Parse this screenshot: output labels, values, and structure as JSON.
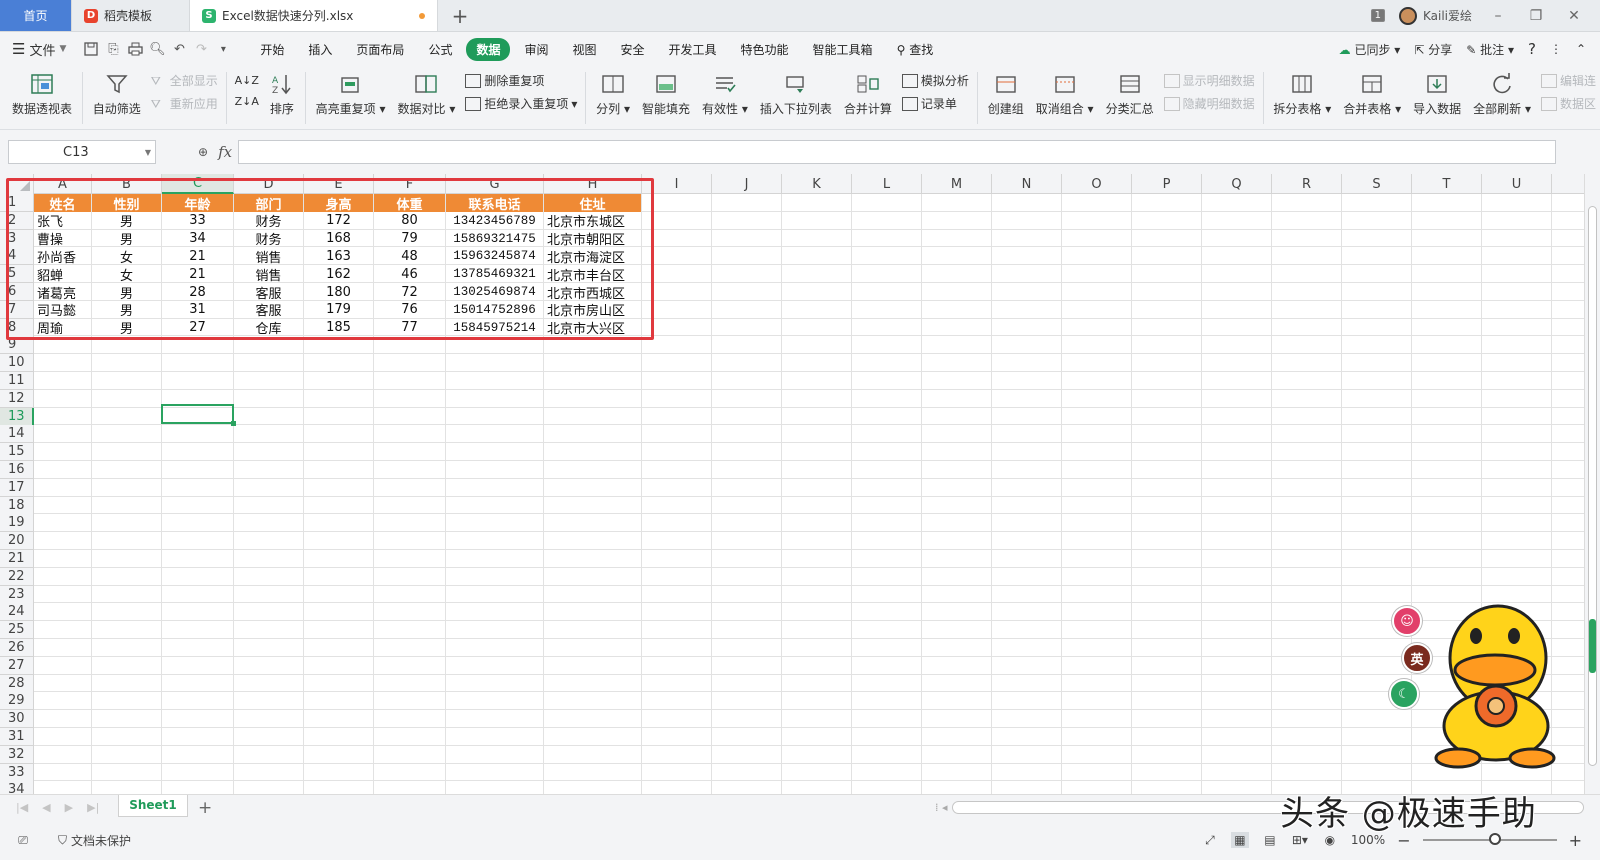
{
  "tabs": {
    "home": "首页",
    "template": "稻壳模板",
    "file": "Excel数据快速分列.xlsx",
    "window_count": "1",
    "user_name": "Kaili爱绘"
  },
  "menu": {
    "file": "文件",
    "items": [
      "开始",
      "插入",
      "页面布局",
      "公式",
      "数据",
      "审阅",
      "视图",
      "安全",
      "开发工具",
      "特色功能",
      "智能工具箱"
    ],
    "active": "数据",
    "search": "查找",
    "synced": "已同步",
    "share": "分享",
    "comment": "批注"
  },
  "ribbon": {
    "pivot": "数据透视表",
    "auto_filter": "自动筛选",
    "show_all": "全部显示",
    "reapply": "重新应用",
    "sort": "排序",
    "highlight_dup": "高亮重复项",
    "compare": "数据对比",
    "remove_dup": "删除重复项",
    "reject_dup": "拒绝录入重复项",
    "split_col": "分列",
    "smart_fill": "智能填充",
    "validity": "有效性",
    "dropdown": "插入下拉列表",
    "merge_calc": "合并计算",
    "simulate": "模拟分析",
    "record": "记录单",
    "create_group": "创建组",
    "ungroup": "取消组合",
    "subtotal": "分类汇总",
    "show_detail": "显示明细数据",
    "hide_detail": "隐藏明细数据",
    "split_table": "拆分表格",
    "merge_table": "合并表格",
    "import": "导入数据",
    "refresh_all": "全部刷新",
    "edit_link": "编辑连",
    "data_source": "数据区"
  },
  "formula": {
    "namebox": "C13",
    "fx": "fx",
    "content": ""
  },
  "columns": [
    "A",
    "B",
    "C",
    "D",
    "E",
    "F",
    "G",
    "H",
    "I",
    "J",
    "K",
    "L",
    "M",
    "N",
    "O",
    "P",
    "Q",
    "R",
    "S",
    "T",
    "U"
  ],
  "rows": [
    "1",
    "2",
    "3",
    "4",
    "5",
    "6",
    "7",
    "8",
    "9",
    "10",
    "11",
    "12",
    "13",
    "14",
    "15",
    "16",
    "17",
    "18",
    "19",
    "20",
    "21",
    "22",
    "23",
    "24",
    "25",
    "26",
    "27",
    "28",
    "29",
    "30",
    "31",
    "32",
    "33",
    "34"
  ],
  "table": {
    "header": [
      "姓名",
      "性别",
      "年龄",
      "部门",
      "身高",
      "体重",
      "联系电话",
      "住址"
    ],
    "rows": [
      [
        "张飞",
        "男",
        "33",
        "财务",
        "172",
        "80",
        "13423456789",
        "北京市东城区"
      ],
      [
        "曹操",
        "男",
        "34",
        "财务",
        "168",
        "79",
        "15869321475",
        "北京市朝阳区"
      ],
      [
        "孙尚香",
        "女",
        "21",
        "销售",
        "163",
        "48",
        "15963245874",
        "北京市海淀区"
      ],
      [
        "貂蝉",
        "女",
        "21",
        "销售",
        "162",
        "46",
        "13785469321",
        "北京市丰台区"
      ],
      [
        "诸葛亮",
        "男",
        "28",
        "客服",
        "180",
        "72",
        "13025469874",
        "北京市西城区"
      ],
      [
        "司马懿",
        "男",
        "31",
        "客服",
        "179",
        "76",
        "15014752896",
        "北京市房山区"
      ],
      [
        "周瑜",
        "男",
        "27",
        "仓库",
        "185",
        "77",
        "15845975214",
        "北京市大兴区"
      ]
    ]
  },
  "sheet_tab": "Sheet1",
  "status": {
    "protect": "文档未保护",
    "zoom": "100%"
  },
  "float_buttons": {
    "ime": "英"
  },
  "watermark": "头条 @极速手助",
  "colors": {
    "accent_green": "#1f9b5a",
    "header_orange": "#ef8a35",
    "highlight_red": "#e0393e"
  }
}
